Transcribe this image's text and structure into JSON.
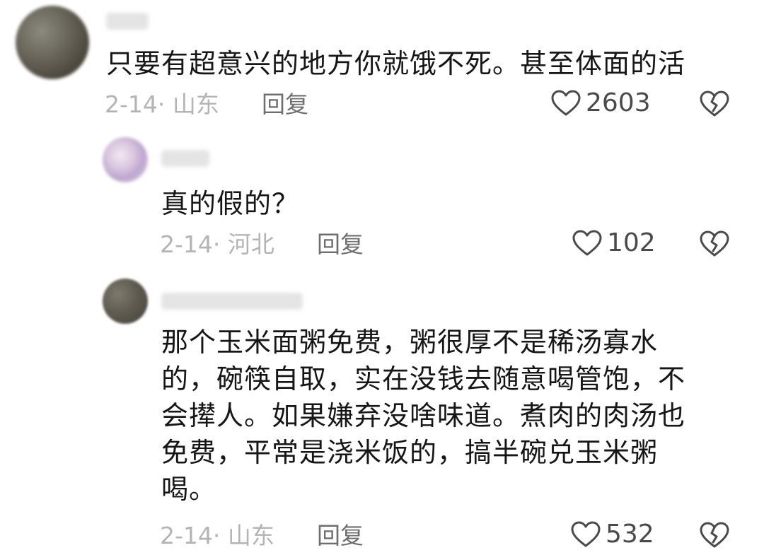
{
  "comments": [
    {
      "text": "只要有超意兴的地方你就饿不死。甚至体面的活",
      "date_location": "2-14· 山东",
      "reply_label": "回复",
      "like_count": "2603",
      "icons": {
        "like": "heart-outline-icon",
        "dislike": "broken-heart-icon"
      }
    },
    {
      "text": "真的假的？",
      "date_location": "2-14· 河北",
      "reply_label": "回复",
      "like_count": "102",
      "icons": {
        "like": "heart-outline-icon",
        "dislike": "broken-heart-icon"
      }
    },
    {
      "text_lines": [
        "那个玉米面粥免费，粥很厚不是稀汤寡水",
        "的，碗筷自取，实在没钱去随意喝管饱，不",
        "会撵人。如果嫌弃没啥味道。煮肉的肉汤也",
        "免费，平常是浇米饭的，搞半碗兑玉米粥",
        "喝。"
      ],
      "date_location": "2-14· 山东",
      "reply_label": "回复",
      "like_count": "532",
      "icons": {
        "like": "heart-outline-icon",
        "dislike": "broken-heart-icon"
      }
    }
  ],
  "colors": {
    "text": "#161616",
    "meta": "#b4b4b4",
    "reply": "#6e6e6e",
    "icon": "#4a4a4a"
  }
}
